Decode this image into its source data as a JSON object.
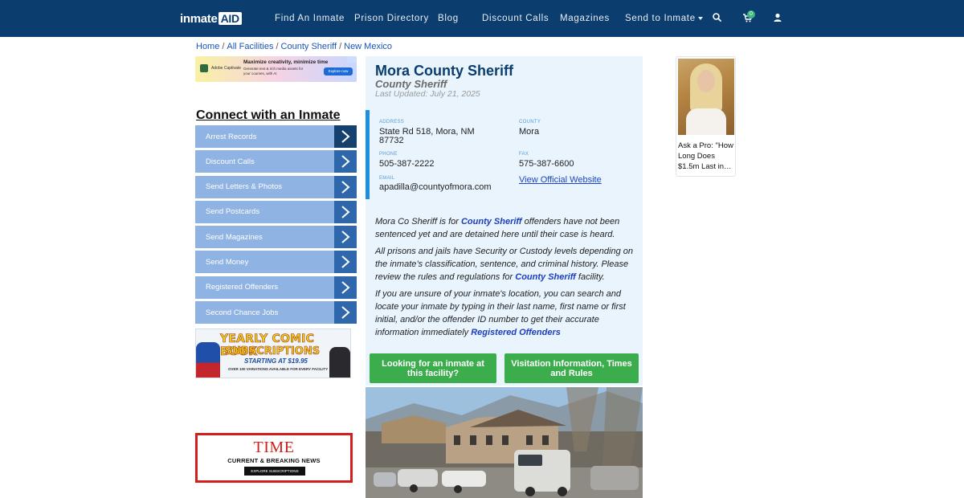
{
  "nav": {
    "logo_left": "inmate",
    "logo_right": "AID",
    "items": [
      "Find An Inmate",
      "Prison Directory",
      "Blog",
      "Discount Calls",
      "Magazines",
      "Send to Inmate"
    ],
    "cart_count": "0",
    "icons": [
      "search-icon",
      "cart-icon",
      "user-icon"
    ]
  },
  "breadcrumb": [
    "Home",
    "All Facilities",
    "County Sheriff",
    "New Mexico"
  ],
  "ad_top": {
    "brand": "Adobe Captivate",
    "headline": "Maximize creativity, minimize time",
    "sub": "Generate text & rich media assets for your courses, with AI",
    "cta": "Explore now"
  },
  "sidebar": {
    "title": "Connect with an Inmate",
    "items": [
      "Arrest Records",
      "Discount Calls",
      "Send Letters & Photos",
      "Send Postcards",
      "Send Magazines",
      "Send Money",
      "Registered Offenders",
      "Second Chance Jobs"
    ]
  },
  "comic_ad": {
    "line1": "YEARLY COMIC BOOK",
    "line2": "SUBSCRIPTIONS",
    "line3": "STARTING AT $19.95",
    "line4": "OVER 100 VARIATIONS AVAILABLE FOR EVERY FACILITY"
  },
  "time_ad": {
    "brand": "TIME",
    "tagline": "CURRENT & BREAKING NEWS",
    "cta": "EXPLORE SUBSCRIPTIONS"
  },
  "facility": {
    "name": "Mora County Sheriff",
    "type": "County Sheriff",
    "updated": "Last Updated: July 21, 2025",
    "address_label": "ADDRESS",
    "address_1": "State Rd 518, Mora, NM",
    "address_2": "87732",
    "county_label": "COUNTY",
    "county": "Mora",
    "phone_label": "PHONE",
    "phone": "505-387-2222",
    "fax_label": "FAX",
    "fax": "575-387-6600",
    "email_label": "EMAIL",
    "email": "apadilla@countyofmora.com",
    "website": "View Official Website"
  },
  "description": {
    "p1_a": "Mora Co Sheriff is for ",
    "p1_link": "County Sheriff",
    "p1_b": " offenders have not been sentenced yet and are detained here until their case is heard.",
    "p2_a": "All prisons and jails have Security or Custody levels depending on the inmate’s classification, sentence, and criminal history. Please review the rules and regulations for ",
    "p2_link": "County Sheriff",
    "p2_b": " facility.",
    "p3_a": "If you are unsure of your inmate's location, you can search and locate your inmate by typing in their last name, first name or first initial, and/or the offender ID number to get their accurate information immediately ",
    "p3_link": "Registered Offenders"
  },
  "buttons": {
    "find_inmate": "Looking for an inmate at this facility?",
    "visitation": "Visitation Information, Times and Rules"
  },
  "pro_card": {
    "text": "Ask a Pro: \"How Long Does $1.5m Last in…"
  },
  "colors": {
    "nav_bg": "#0b3d6e",
    "sidebar_item": "#8fb3e3",
    "sidebar_arrow": "#2f67ad",
    "green_button": "#3bad4c",
    "card_bg": "#e9f4fd",
    "title": "#0b3d6e"
  }
}
